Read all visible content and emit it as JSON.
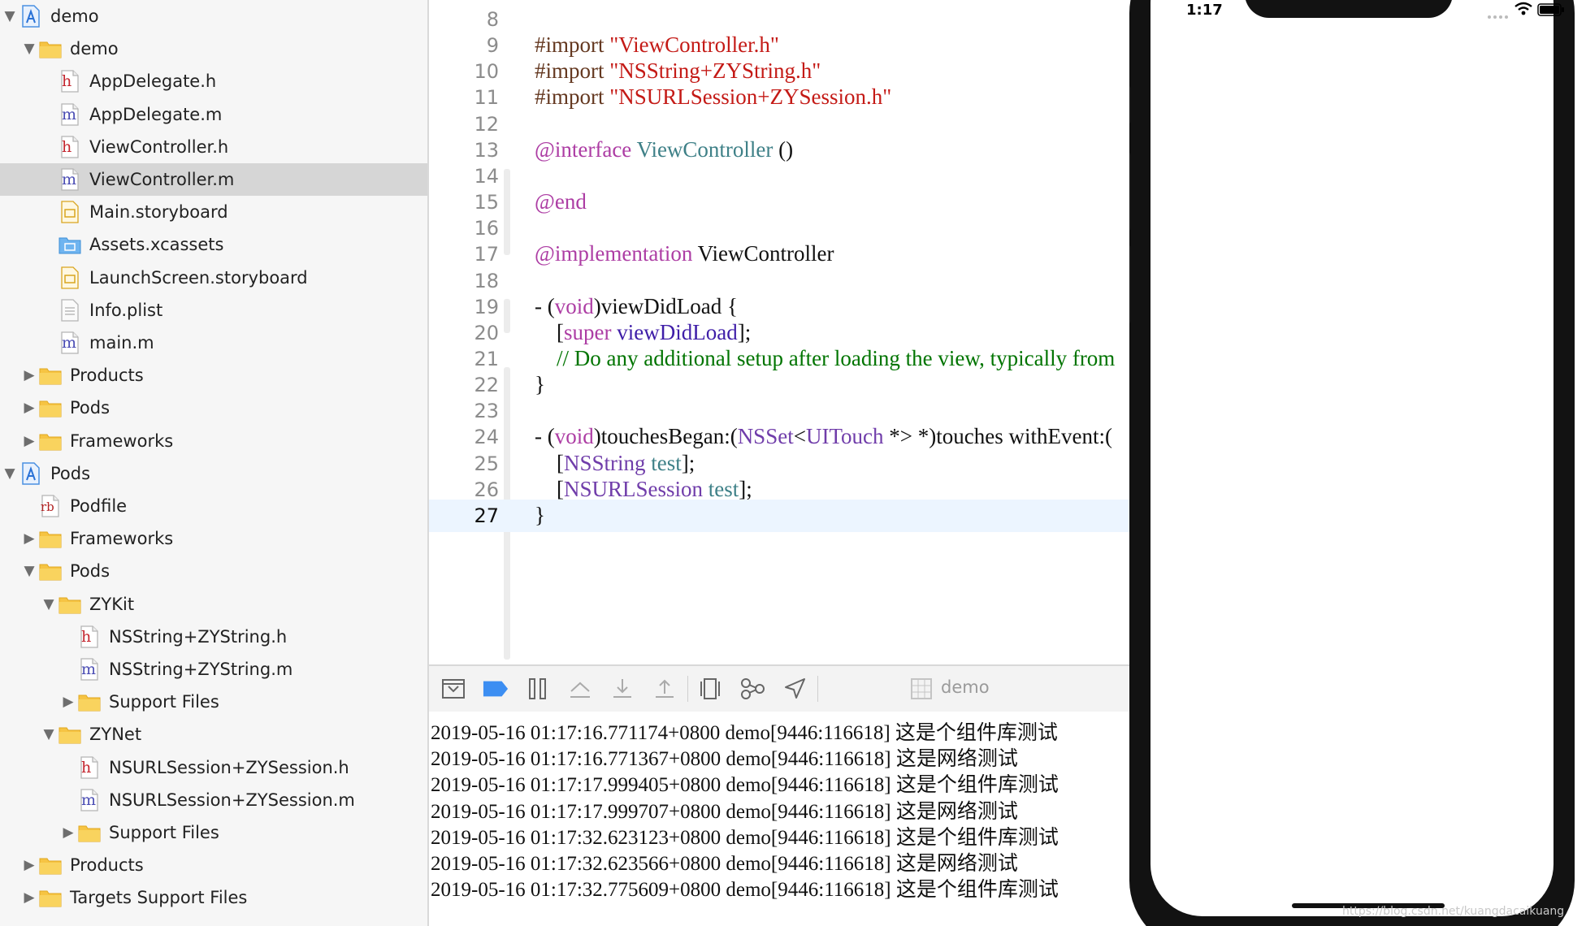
{
  "navigator": {
    "items": [
      {
        "label": "demo",
        "kind": "project",
        "expanded": true,
        "level": 0
      },
      {
        "label": "demo",
        "kind": "folder",
        "expanded": true,
        "level": 1
      },
      {
        "label": "AppDelegate.h",
        "kind": "h",
        "level": 2
      },
      {
        "label": "AppDelegate.m",
        "kind": "m",
        "level": 2
      },
      {
        "label": "ViewController.h",
        "kind": "h",
        "level": 2
      },
      {
        "label": "ViewController.m",
        "kind": "m",
        "level": 2,
        "selected": true
      },
      {
        "label": "Main.storyboard",
        "kind": "storyboard",
        "level": 2
      },
      {
        "label": "Assets.xcassets",
        "kind": "assets",
        "level": 2
      },
      {
        "label": "LaunchScreen.storyboard",
        "kind": "storyboard",
        "level": 2
      },
      {
        "label": "Info.plist",
        "kind": "plist",
        "level": 2
      },
      {
        "label": "main.m",
        "kind": "m",
        "level": 2
      },
      {
        "label": "Products",
        "kind": "folder",
        "expanded": false,
        "level": 1
      },
      {
        "label": "Pods",
        "kind": "folder",
        "expanded": false,
        "level": 1
      },
      {
        "label": "Frameworks",
        "kind": "folder",
        "expanded": false,
        "level": 1
      },
      {
        "label": "Pods",
        "kind": "project",
        "expanded": true,
        "level": 0
      },
      {
        "label": "Podfile",
        "kind": "rb",
        "level": 1
      },
      {
        "label": "Frameworks",
        "kind": "folder",
        "expanded": false,
        "level": 1
      },
      {
        "label": "Pods",
        "kind": "folder",
        "expanded": true,
        "level": 1
      },
      {
        "label": "ZYKit",
        "kind": "folder",
        "expanded": true,
        "level": 2
      },
      {
        "label": "NSString+ZYString.h",
        "kind": "h",
        "level": 3
      },
      {
        "label": "NSString+ZYString.m",
        "kind": "m",
        "level": 3
      },
      {
        "label": "Support Files",
        "kind": "folder",
        "expanded": false,
        "level": 3
      },
      {
        "label": "ZYNet",
        "kind": "folder",
        "expanded": true,
        "level": 2
      },
      {
        "label": "NSURLSession+ZYSession.h",
        "kind": "h",
        "level": 3
      },
      {
        "label": "NSURLSession+ZYSession.m",
        "kind": "m",
        "level": 3
      },
      {
        "label": "Support Files",
        "kind": "folder",
        "expanded": false,
        "level": 3
      },
      {
        "label": "Products",
        "kind": "folder",
        "expanded": false,
        "level": 1
      },
      {
        "label": "Targets Support Files",
        "kind": "folder",
        "expanded": false,
        "level": 1
      }
    ]
  },
  "editor": {
    "current_line": 27,
    "lines": [
      {
        "n": 8,
        "tokens": []
      },
      {
        "n": 9,
        "tokens": [
          {
            "t": "#import ",
            "c": "dir"
          },
          {
            "t": "\"ViewController.h\"",
            "c": "str"
          }
        ]
      },
      {
        "n": 10,
        "tokens": [
          {
            "t": "#import ",
            "c": "dir"
          },
          {
            "t": "\"NSString+ZYString.h\"",
            "c": "str"
          }
        ]
      },
      {
        "n": 11,
        "tokens": [
          {
            "t": "#import ",
            "c": "dir"
          },
          {
            "t": "\"NSURLSession+ZYSession.h\"",
            "c": "str"
          }
        ]
      },
      {
        "n": 12,
        "tokens": []
      },
      {
        "n": 13,
        "tokens": [
          {
            "t": "@interface",
            "c": "kw"
          },
          {
            "t": " ",
            "c": "pln"
          },
          {
            "t": "ViewController",
            "c": "cls"
          },
          {
            "t": " ()",
            "c": "pln"
          }
        ]
      },
      {
        "n": 14,
        "tokens": []
      },
      {
        "n": 15,
        "tokens": [
          {
            "t": "@end",
            "c": "kw"
          }
        ]
      },
      {
        "n": 16,
        "tokens": []
      },
      {
        "n": 17,
        "tokens": [
          {
            "t": "@implementation",
            "c": "kw"
          },
          {
            "t": " ViewController",
            "c": "pln"
          }
        ]
      },
      {
        "n": 18,
        "tokens": []
      },
      {
        "n": 19,
        "tokens": [
          {
            "t": "- (",
            "c": "pln"
          },
          {
            "t": "void",
            "c": "kw"
          },
          {
            "t": ")viewDidLoad {",
            "c": "pln"
          }
        ]
      },
      {
        "n": 20,
        "tokens": [
          {
            "t": "    [",
            "c": "pln"
          },
          {
            "t": "super",
            "c": "kw"
          },
          {
            "t": " ",
            "c": "pln"
          },
          {
            "t": "viewDidLoad",
            "c": "msg"
          },
          {
            "t": "];",
            "c": "pln"
          }
        ]
      },
      {
        "n": 21,
        "tokens": [
          {
            "t": "    // Do any additional setup after loading the view, typically from",
            "c": "cmt"
          }
        ]
      },
      {
        "n": 22,
        "tokens": [
          {
            "t": "}",
            "c": "pln"
          }
        ]
      },
      {
        "n": 23,
        "tokens": []
      },
      {
        "n": 24,
        "tokens": [
          {
            "t": "- (",
            "c": "pln"
          },
          {
            "t": "void",
            "c": "kw"
          },
          {
            "t": ")touchesBegan:(",
            "c": "pln"
          },
          {
            "t": "NSSet",
            "c": "typ"
          },
          {
            "t": "<",
            "c": "pln"
          },
          {
            "t": "UITouch",
            "c": "typ"
          },
          {
            "t": " *> *)touches withEvent:(",
            "c": "pln"
          }
        ]
      },
      {
        "n": 25,
        "tokens": [
          {
            "t": "    [",
            "c": "pln"
          },
          {
            "t": "NSString",
            "c": "typ"
          },
          {
            "t": " ",
            "c": "pln"
          },
          {
            "t": "test",
            "c": "cls"
          },
          {
            "t": "];",
            "c": "pln"
          }
        ]
      },
      {
        "n": 26,
        "tokens": [
          {
            "t": "    [",
            "c": "pln"
          },
          {
            "t": "NSURLSession",
            "c": "typ"
          },
          {
            "t": " ",
            "c": "pln"
          },
          {
            "t": "test",
            "c": "cls"
          },
          {
            "t": "];",
            "c": "pln"
          }
        ]
      },
      {
        "n": 27,
        "tokens": [
          {
            "t": "}",
            "c": "pln"
          }
        ]
      }
    ]
  },
  "debug_bar": {
    "buttons": [
      "hide-debug-area",
      "breakpoints-toggle",
      "pause-continue",
      "step-over",
      "step-into",
      "step-out",
      "view-debugger",
      "memory-graph",
      "simulate-location"
    ],
    "scheme": "demo"
  },
  "console": {
    "lines": [
      "2019-05-16 01:17:16.771174+0800 demo[9446:116618] 这是个组件库测试",
      "2019-05-16 01:17:16.771367+0800 demo[9446:116618] 这是网络测试",
      "2019-05-16 01:17:17.999405+0800 demo[9446:116618] 这是个组件库测试",
      "2019-05-16 01:17:17.999707+0800 demo[9446:116618] 这是网络测试",
      "2019-05-16 01:17:32.623123+0800 demo[9446:116618] 这是个组件库测试",
      "2019-05-16 01:17:32.623566+0800 demo[9446:116618] 这是网络测试",
      "2019-05-16 01:17:32.775609+0800 demo[9446:116618] 这是个组件库测试"
    ]
  },
  "simulator": {
    "status_time": "1:17",
    "watermark": "https://blog.csdn.net/kuangdacaikuang"
  },
  "colors": {
    "directive": "#643820",
    "string": "#c41a16",
    "keyword": "#ad3da4",
    "class": "#3e8087",
    "type": "#703daa",
    "message": "#3f1ea8",
    "comment": "#007400",
    "selection": "#d6d6d6",
    "current_line": "#ecf5ff",
    "breakpoint": "#3c8ef2",
    "folder": "#f6c443"
  }
}
